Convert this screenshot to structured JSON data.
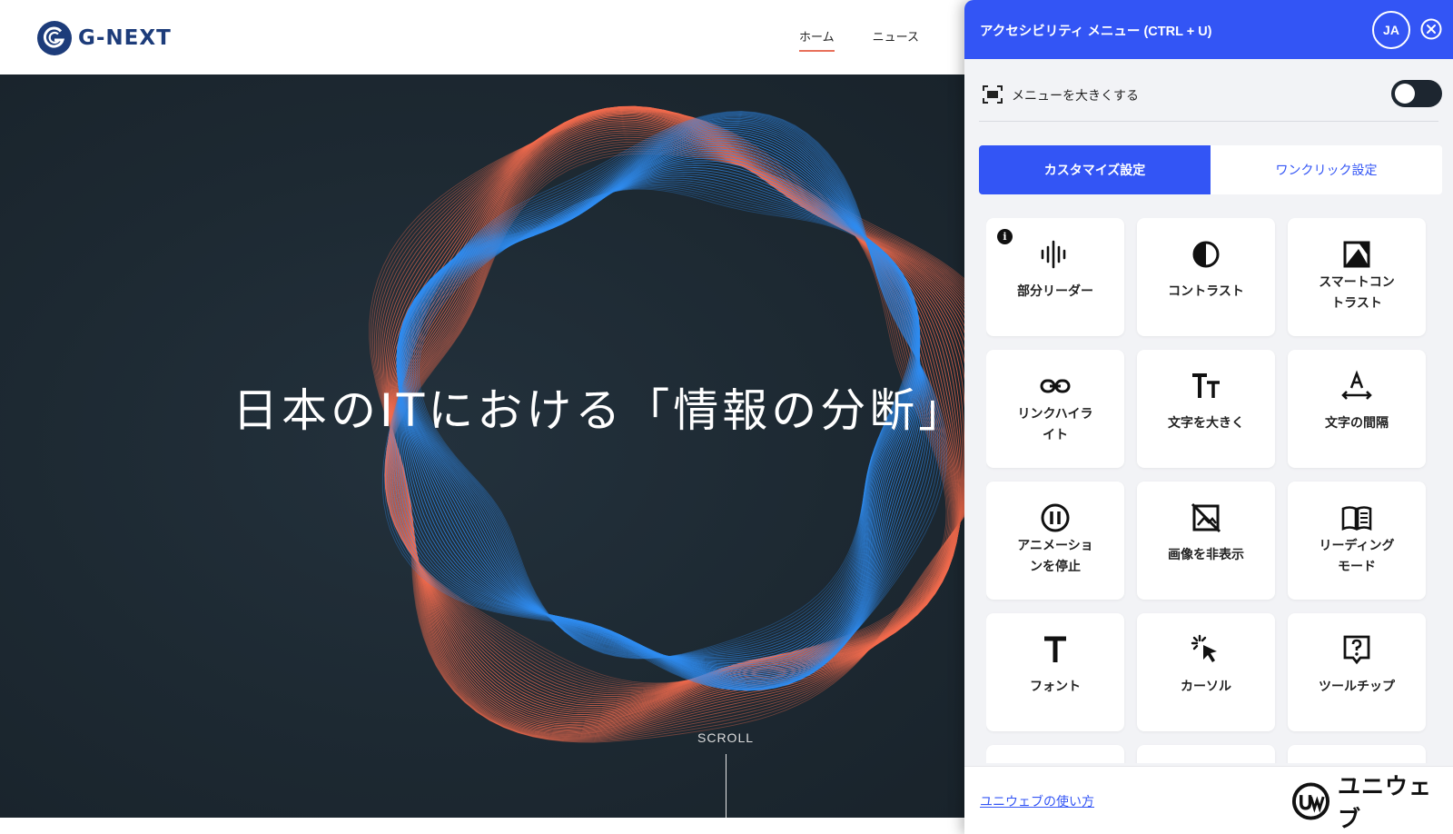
{
  "site": {
    "logo_text": "G-NEXT",
    "nav": [
      "ホーム",
      "ニュース"
    ],
    "hero_title": "日本のITにおける「情報の分断」",
    "scroll_label": "SCROLL"
  },
  "panel": {
    "title": "アクセシビリティ メニュー (CTRL + U)",
    "language": "JA",
    "enlarge_label": "メニューを大きくする",
    "enlarge_on": false,
    "tabs": [
      "カスタマイズ設定",
      "ワンクリック設定"
    ],
    "active_tab": 0,
    "features": [
      {
        "label": "部分リーダー",
        "icon": "audio-wave-icon",
        "info": "i"
      },
      {
        "label": "コントラスト",
        "icon": "contrast-icon"
      },
      {
        "label": "スマートコン\nトラスト",
        "icon": "smart-contrast-icon"
      },
      {
        "label": "リンクハイラ\nイト",
        "icon": "link-icon"
      },
      {
        "label": "文字を大きく",
        "icon": "text-size-icon"
      },
      {
        "label": "文字の間隔",
        "icon": "letter-spacing-icon"
      },
      {
        "label": "アニメーショ\nンを停止",
        "icon": "pause-icon"
      },
      {
        "label": "画像を非表示",
        "icon": "hide-image-icon"
      },
      {
        "label": "リーディング\nモード",
        "icon": "book-icon"
      },
      {
        "label": "フォント",
        "icon": "font-icon"
      },
      {
        "label": "カーソル",
        "icon": "cursor-icon"
      },
      {
        "label": "ツールチップ",
        "icon": "tooltip-icon"
      }
    ],
    "footer_link": "ユニウェブの使い方",
    "brand_text": "ユニウェブ",
    "colors": {
      "accent": "#3355f5",
      "hero_bg": "#1d2932",
      "wave_orange": "#f26b4d",
      "wave_blue": "#2f8cf0"
    }
  }
}
